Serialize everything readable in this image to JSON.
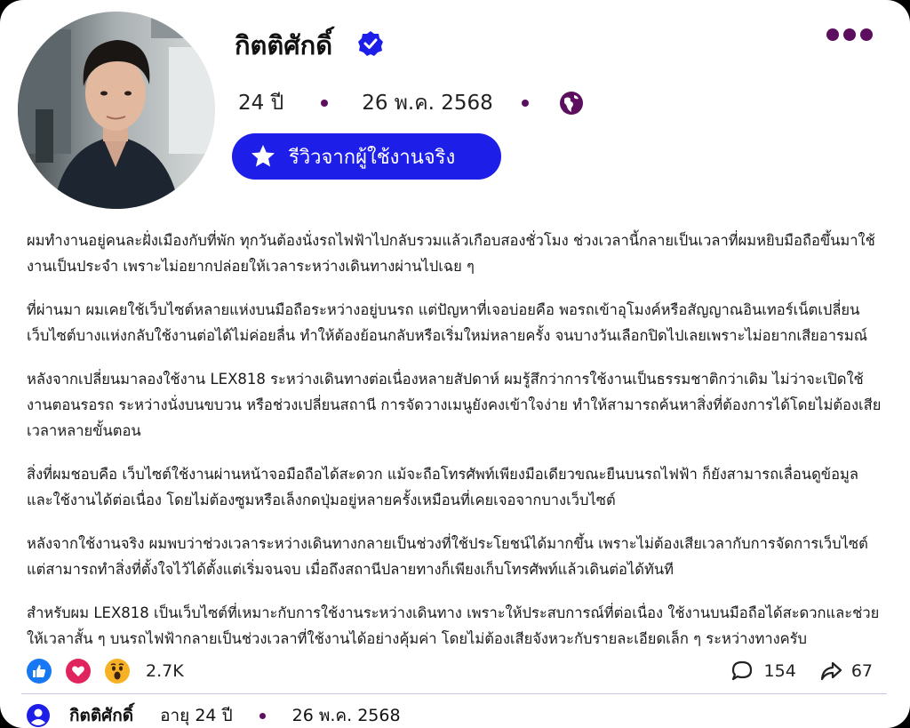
{
  "post": {
    "author": "กิตติศักดิ์",
    "age": "24 ปี",
    "date": "26 พ.ค. 2568",
    "review_label": "รีวิวจากผู้ใช้งานจริง",
    "paragraphs": [
      "ผมทำงานอยู่คนละฝั่งเมืองกับที่พัก ทุกวันต้องนั่งรถไฟฟ้าไปกลับรวมแล้วเกือบสองชั่วโมง ช่วงเวลานี้กลายเป็นเวลาที่ผมหยิบมือถือขึ้นมาใช้งานเป็นประจำ เพราะไม่อยากปล่อยให้เวลาระหว่างเดินทางผ่านไปเฉย ๆ",
      "ที่ผ่านมา ผมเคยใช้เว็บไซต์หลายแห่งบนมือถือระหว่างอยู่บนรถ แต่ปัญหาที่เจอบ่อยคือ พอรถเข้าอุโมงค์หรือสัญญาณอินเทอร์เน็ตเปลี่ยน เว็บไซต์บางแห่งกลับใช้งานต่อได้ไม่ค่อยลื่น ทำให้ต้องย้อนกลับหรือเริ่มใหม่หลายครั้ง จนบางวันเลือกปิดไปเลยเพราะไม่อยากเสียอารมณ์",
      "หลังจากเปลี่ยนมาลองใช้งาน LEX818 ระหว่างเดินทางต่อเนื่องหลายสัปดาห์ ผมรู้สึกว่าการใช้งานเป็นธรรมชาติกว่าเดิม ไม่ว่าจะเปิดใช้งานตอนรอรถ ระหว่างนั่งบนขบวน หรือช่วงเปลี่ยนสถานี การจัดวางเมนูยังคงเข้าใจง่าย ทำให้สามารถค้นหาสิ่งที่ต้องการได้โดยไม่ต้องเสียเวลาหลายขั้นตอน",
      "สิ่งที่ผมชอบคือ เว็บไซต์ใช้งานผ่านหน้าจอมือถือได้สะดวก แม้จะถือโทรศัพท์เพียงมือเดียวขณะยืนบนรถไฟฟ้า ก็ยังสามารถเลื่อนดูข้อมูลและใช้งานได้ต่อเนื่อง โดยไม่ต้องซูมหรือเล็งกดปุ่มอยู่หลายครั้งเหมือนที่เคยเจอจากบางเว็บไซต์",
      "หลังจากใช้งานจริง ผมพบว่าช่วงเวลาระหว่างเดินทางกลายเป็นช่วงที่ใช้ประโยชน์ได้มากขึ้น เพราะไม่ต้องเสียเวลากับการจัดการเว็บไซต์ แต่สามารถทำสิ่งที่ตั้งใจไว้ได้ตั้งแต่เริ่มจนจบ เมื่อถึงสถานีปลายทางก็เพียงเก็บโทรศัพท์แล้วเดินต่อได้ทันที",
      "สำหรับผม LEX818 เป็นเว็บไซต์ที่เหมาะกับการใช้งานระหว่างเดินทาง เพราะให้ประสบการณ์ที่ต่อเนื่อง ใช้งานบนมือถือได้สะดวกและช่วยให้เวลาสั้น ๆ บนรถไฟฟ้ากลายเป็นช่วงเวลาที่ใช้งานได้อย่างคุ้มค่า โดยไม่ต้องเสียจังหวะกับรายละเอียดเล็ก ๆ ระหว่างทางครับ"
    ],
    "reaction_count": "2.7K",
    "comment_count": "154",
    "share_count": "67"
  },
  "footer": {
    "name": "กิตติศักดิ์",
    "age": "อายุ 24 ปี",
    "date": "26 พ.ค. 2568"
  },
  "colors": {
    "accent": "#1d1ee8",
    "dots": "#5b0f5e",
    "like": "#1877f2",
    "love": "#e0245e",
    "wow": "#f7b125"
  },
  "icons": [
    "verified-badge-icon",
    "more-dots-icon",
    "globe-icon",
    "star-icon",
    "like-icon",
    "heart-icon",
    "wow-icon",
    "comment-icon",
    "share-icon",
    "user-icon"
  ]
}
